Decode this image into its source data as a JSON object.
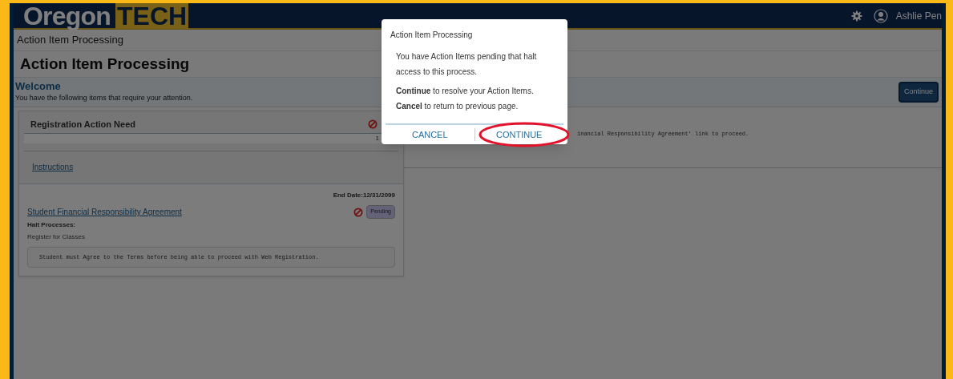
{
  "header": {
    "logo_word": "Oregon",
    "logo_badge": "TECH",
    "user_name": "Ashlie Pen"
  },
  "breadcrumb": "Action Item Processing",
  "page_title": "Action Item Processing",
  "welcome": {
    "heading": "Welcome",
    "text": "You have the following items that require your attention.",
    "button": "Continue"
  },
  "group": {
    "title": "Registration Action Need",
    "count": "1",
    "instructions_link": "Instructions"
  },
  "item": {
    "end_date": "End Date:12/31/2099",
    "title": "Student Financial Responsibility Agreement",
    "status": "Pending",
    "halt_label": "Halt Processes:",
    "halt_process": "Register for Classes",
    "message": "Student must Agree to the Terms before being able to proceed with Web Registration."
  },
  "detail_text": "inancial Responsibility Agreement' link  to proceed.",
  "dialog": {
    "title": "Action Item Processing",
    "message": "You have Action Items pending that halt access to this process.",
    "lines": [
      "**Continue** to resolve your Action Items.",
      "**Cancel** to return to previous page."
    ],
    "buttons": [
      {
        "label": "CANCEL",
        "highlighted": false
      },
      {
        "label": "CONTINUE",
        "highlighted": true
      }
    ]
  }
}
